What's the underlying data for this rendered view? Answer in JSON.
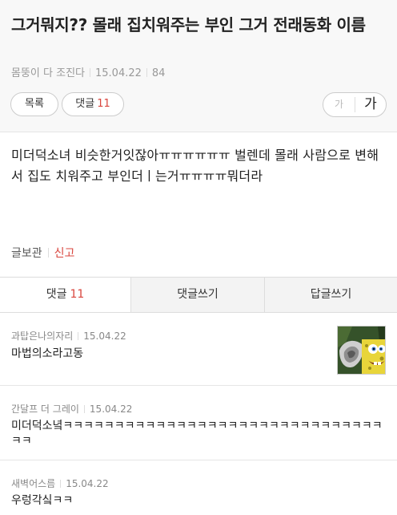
{
  "post": {
    "title": "그거뭐지?? 몰래 집치워주는 부인 그거 전래동화 이름",
    "author": "몸뚱이 다 조진다",
    "date": "15.04.22",
    "views": "84",
    "body": "미더덕소녀 비슷한거잇잖아ㅠㅠㅠㅠㅠㅠ 벌렌데 몰래 사람으로 변해서 집도 치워주고 부인더ㅣ는거ㅠㅠㅠㅠ뭐더라"
  },
  "toolbar": {
    "list_label": "목록",
    "comment_label": "댓글",
    "comment_count": "11",
    "font_small": "가",
    "font_large": "가"
  },
  "post_actions": {
    "save_label": "글보관",
    "report_label": "신고"
  },
  "tabs": {
    "comments_label": "댓글",
    "comments_count": "11",
    "write_comment_label": "댓글쓰기",
    "write_reply_label": "답글쓰기"
  },
  "comments": [
    {
      "author": "과탑은나의자리",
      "date": "15.04.22",
      "text": "마법의소라고동"
    },
    {
      "author": "간달프 더 그레이",
      "date": "15.04.22",
      "text": "미더덕소녘ㅋㅋㅋㅋㅋㅋㅋㅋㅋㅋㅋㅋㅋㅋㅋㅋㅋㅋㅋㅋㅋㅋㅋㅋㅋㅋㅋㅋㅋㅋㅋㅋㅋ"
    },
    {
      "author": "새벽어스름",
      "date": "15.04.22",
      "text": "우렁각싴ㅋㅋ"
    }
  ]
}
